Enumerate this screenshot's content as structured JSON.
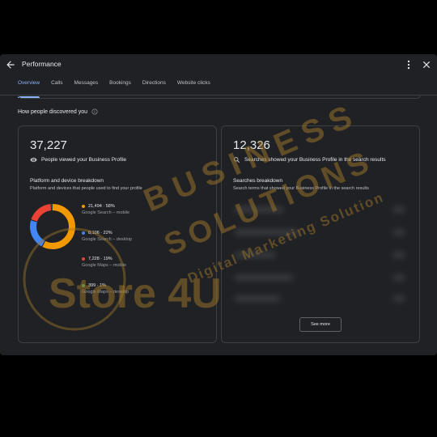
{
  "window": {
    "title": "Performance"
  },
  "tabs": [
    {
      "label": "Overview",
      "active": true
    },
    {
      "label": "Calls",
      "active": false
    },
    {
      "label": "Messages",
      "active": false
    },
    {
      "label": "Bookings",
      "active": false
    },
    {
      "label": "Directions",
      "active": false
    },
    {
      "label": "Website clicks",
      "active": false
    }
  ],
  "section": {
    "heading": "How people discovered you"
  },
  "views_card": {
    "total": "37,227",
    "total_label": "People viewed your Business Profile",
    "breakdown_title": "Platform and device breakdown",
    "breakdown_desc": "Platform and devices that people used to find your profile",
    "items": [
      {
        "value": "21,494 · 58%",
        "label": "Google Search – mobile",
        "color": "#f29900",
        "fraction": 0.58
      },
      {
        "value": "8,106 · 22%",
        "label": "Google Search – desktop",
        "color": "#4285f4",
        "fraction": 0.22
      },
      {
        "value": "7,228 · 19%",
        "label": "Google Maps – mobile",
        "color": "#ea4335",
        "fraction": 0.19
      },
      {
        "value": "399 · 1%",
        "label": "Google Maps – desktop",
        "color": "#34a853",
        "fraction": 0.01
      }
    ]
  },
  "searches_card": {
    "total": "12,326",
    "total_label": "Searches showed your Business Profile in the search results",
    "breakdown_title": "Searches breakdown",
    "breakdown_desc": "Search terms that showed your Business Profile in the search results",
    "see_more": "See more"
  },
  "watermark": {
    "line1": "BUSINESS",
    "line2": "SOLUTIONS",
    "line3": "Digital Marketing Solution",
    "logo_text": "Store 4U",
    "color": "#a0782a"
  },
  "icons": {
    "back": "arrow-back-icon",
    "more": "more-vert-icon",
    "close": "close-icon",
    "info": "info-icon",
    "eye": "eye-icon",
    "search": "search-icon"
  }
}
